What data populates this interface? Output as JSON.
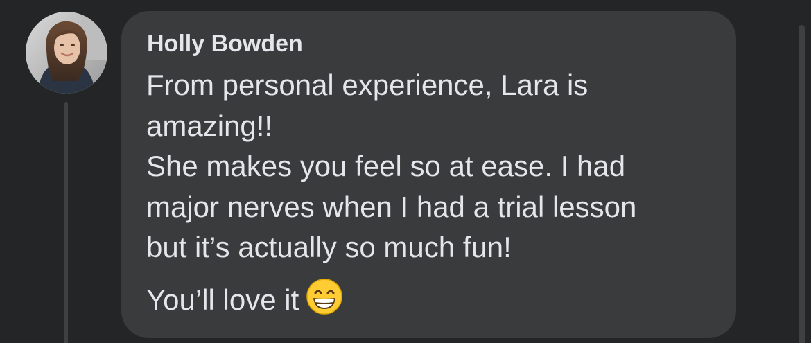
{
  "comment": {
    "author": "Holly Bowden",
    "lines": [
      "From personal experience, Lara is",
      "amazing!!",
      "She makes you feel so at ease. I had",
      "major nerves when I had a trial lesson",
      "but it’s actually so much fun!"
    ],
    "closing_line": "You’ll love it",
    "closing_emoji": "grinning-face-with-smiling-eyes-emoji"
  },
  "avatar": {
    "icon": "profile-photo"
  },
  "colors": {
    "background": "#242526",
    "bubble": "#3a3b3c",
    "text": "#e4e6eb",
    "thread_line": "#3e4042",
    "emoji_face": "#ffcc33"
  }
}
